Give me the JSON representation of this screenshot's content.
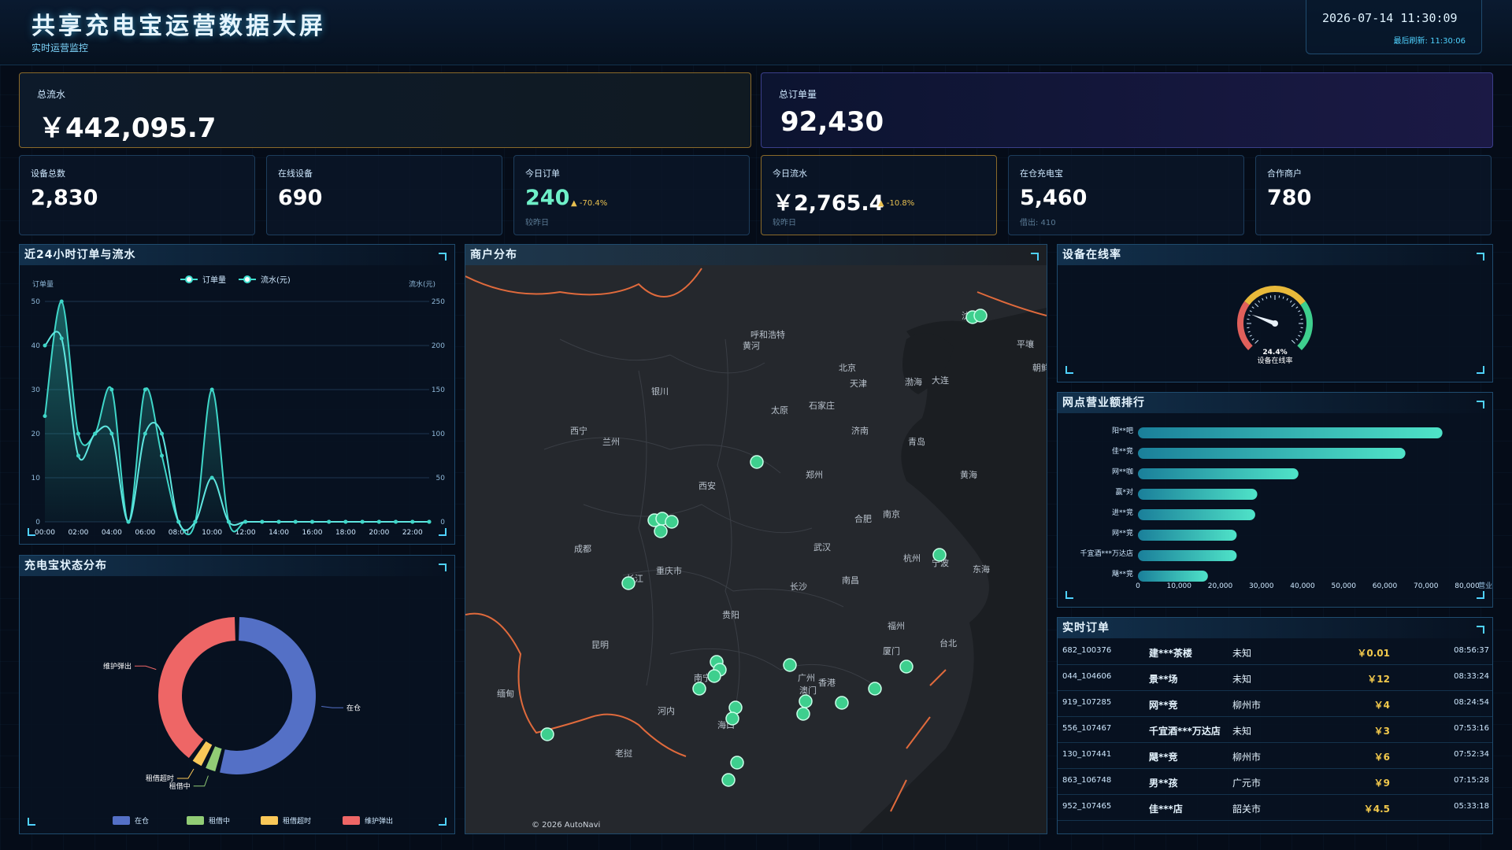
{
  "header": {
    "title": "共享充电宝运营数据大屏",
    "subtitle": "实时运营监控",
    "datetime": "2026-07-14 11:30:09",
    "refresh_label": "最后刷新: 11:30:06"
  },
  "kpi_top": [
    {
      "label": "总流水",
      "value": "￥442,095.7"
    },
    {
      "label": "总订单量",
      "value": "92,430"
    }
  ],
  "kpi": [
    {
      "label": "设备总数",
      "value": "2,830",
      "trend": "",
      "sub": ""
    },
    {
      "label": "在线设备",
      "value": "690",
      "trend": "",
      "sub": ""
    },
    {
      "label": "今日订单",
      "value": "240",
      "trend": "▲ -70.4%",
      "sub": "较昨日"
    },
    {
      "label": "今日流水",
      "value": "￥2,765.4",
      "trend": "▲ -10.8%",
      "sub": "较昨日"
    },
    {
      "label": "在仓充电宝",
      "value": "5,460",
      "trend": "",
      "sub": "借出: 410"
    },
    {
      "label": "合作商户",
      "value": "780",
      "trend": "",
      "sub": ""
    }
  ],
  "panels": {
    "hourly": {
      "title": "近24小时订单与流水",
      "legend_orders": "订单量",
      "legend_revenue": "流水(元)",
      "left_axis": "订单量",
      "right_axis": "流水(元)"
    },
    "map": {
      "title": "商户分布",
      "credit": "© 2026 AutoNavi"
    },
    "online": {
      "title": "设备在线率",
      "value": "24.4%",
      "caption": "设备在线率"
    },
    "ranking": {
      "title": "网点营业额排行",
      "axis_unit": "营业"
    },
    "status": {
      "title": "充电宝状态分布"
    },
    "orders": {
      "title": "实时订单"
    }
  },
  "chart_data": [
    {
      "type": "line",
      "title": "近24小时订单与流水",
      "x": [
        "00:00",
        "01:00",
        "02:00",
        "03:00",
        "04:00",
        "05:00",
        "06:00",
        "07:00",
        "08:00",
        "09:00",
        "10:00",
        "11:00",
        "12:00",
        "13:00",
        "14:00",
        "15:00",
        "16:00",
        "17:00",
        "18:00",
        "19:00",
        "20:00",
        "21:00",
        "22:00",
        "23:00"
      ],
      "xticks": [
        "00:00",
        "02:00",
        "04:00",
        "06:00",
        "08:00",
        "10:00",
        "12:00",
        "14:00",
        "16:00",
        "18:00",
        "20:00",
        "22:00"
      ],
      "series": [
        {
          "name": "订单量",
          "axis": "left",
          "values": [
            24,
            50,
            20,
            20,
            30,
            0,
            30,
            15,
            0,
            0,
            30,
            0,
            0,
            0,
            0,
            0,
            0,
            0,
            0,
            0,
            0,
            0,
            0,
            0
          ]
        },
        {
          "name": "流水(元)",
          "axis": "right",
          "values": [
            200,
            208,
            75,
            100,
            100,
            0,
            100,
            100,
            0,
            0,
            50,
            0,
            0,
            0,
            0,
            0,
            0,
            0,
            0,
            0,
            0,
            0,
            0,
            0
          ]
        }
      ],
      "ylim_left": [
        0,
        50
      ],
      "yticks_left": [
        0,
        10,
        20,
        30,
        40,
        50
      ],
      "ylim_right": [
        0,
        250
      ],
      "yticks_right": [
        0,
        50,
        100,
        150,
        200,
        250
      ],
      "legend": "top"
    },
    {
      "type": "gauge",
      "title": "设备在线率",
      "value": 24.4,
      "unit": "%"
    },
    {
      "type": "bar",
      "title": "网点营业额排行",
      "orientation": "horizontal",
      "categories": [
        "阳**吧",
        "佳**竞",
        "网**咖",
        "赢*对",
        "进**竞",
        "网**竞",
        "千宜酒***万达店",
        "飓**竞"
      ],
      "values": [
        74000,
        65000,
        39000,
        29000,
        28500,
        24000,
        24000,
        17000
      ],
      "xlim": [
        0,
        80000
      ],
      "xticks": [
        "0",
        "10,000",
        "20,000",
        "30,000",
        "40,000",
        "50,000",
        "60,000",
        "70,000",
        "80,000"
      ]
    },
    {
      "type": "pie",
      "title": "充电宝状态分布",
      "categories": [
        "在仓",
        "租借中",
        "租借超时",
        "维护弹出"
      ],
      "values": [
        54,
        3,
        3,
        40
      ],
      "colors": [
        "#5470c6",
        "#91cc75",
        "#fac858",
        "#ee6666"
      ],
      "legend": "bottom"
    }
  ],
  "orders": [
    {
      "id": "682_100376",
      "shop": "建***茶楼",
      "city": "未知",
      "amount": "￥0.01",
      "time": "08:56:37"
    },
    {
      "id": "044_104606",
      "shop": "景**场",
      "city": "未知",
      "amount": "￥12",
      "time": "08:33:24"
    },
    {
      "id": "919_107285",
      "shop": "网**竞",
      "city": "柳州市",
      "amount": "￥4",
      "time": "08:24:54"
    },
    {
      "id": "556_107467",
      "shop": "千宜酒***万达店",
      "city": "未知",
      "amount": "￥3",
      "time": "07:53:16"
    },
    {
      "id": "130_107441",
      "shop": "飓**竞",
      "city": "柳州市",
      "amount": "￥6",
      "time": "07:52:34"
    },
    {
      "id": "863_106748",
      "shop": "男**孩",
      "city": "广元市",
      "amount": "￥9",
      "time": "07:15:28"
    },
    {
      "id": "952_107465",
      "shop": "佳***店",
      "city": "韶关市",
      "amount": "￥4.5",
      "time": "05:33:18"
    }
  ],
  "map_labels": [
    "呼和浩特",
    "黄河",
    "北京",
    "天津",
    "沈阳",
    "银川",
    "太原",
    "石家庄",
    "渤海",
    "大连",
    "西宁",
    "兰州",
    "济南",
    "青岛",
    "黄海",
    "郑州",
    "西安",
    "合肥",
    "南京",
    "成都",
    "武汉",
    "杭州",
    "宁波",
    "东海",
    "重庆市",
    "长江",
    "长沙",
    "南昌",
    "贵阳",
    "福州",
    "昆明",
    "台北",
    "厦门",
    "南宁",
    "广州",
    "澳门",
    "香港",
    "海口",
    "河内",
    "老挝",
    "缅甸",
    "平壤",
    "朝鲜"
  ],
  "colors": {
    "accent": "#4fd2ff",
    "line": "#40e0d0",
    "marker": "#3ecf8e",
    "gold": "#8a6a2a"
  }
}
